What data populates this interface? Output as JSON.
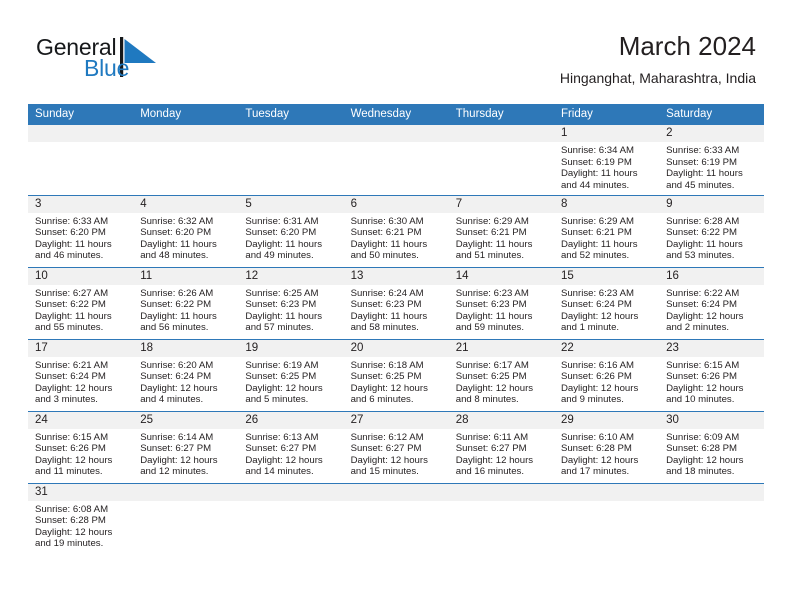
{
  "brand": {
    "name_part1": "General",
    "name_part2": "Blue",
    "mark": "triangle-flag",
    "colors": {
      "blue": "#1f79c0",
      "header_blue": "#2e78b8",
      "band_gray": "#f1f1f1"
    }
  },
  "header": {
    "title": "March 2024",
    "subtitle": "Hinganghat, Maharashtra, India"
  },
  "calendar": {
    "weekday_headers": [
      "Sunday",
      "Monday",
      "Tuesday",
      "Wednesday",
      "Thursday",
      "Friday",
      "Saturday"
    ],
    "weeks": [
      [
        {
          "day": "",
          "sunrise": "",
          "sunset": "",
          "daylight_line1": "",
          "daylight_line2": ""
        },
        {
          "day": "",
          "sunrise": "",
          "sunset": "",
          "daylight_line1": "",
          "daylight_line2": ""
        },
        {
          "day": "",
          "sunrise": "",
          "sunset": "",
          "daylight_line1": "",
          "daylight_line2": ""
        },
        {
          "day": "",
          "sunrise": "",
          "sunset": "",
          "daylight_line1": "",
          "daylight_line2": ""
        },
        {
          "day": "",
          "sunrise": "",
          "sunset": "",
          "daylight_line1": "",
          "daylight_line2": ""
        },
        {
          "day": "1",
          "sunrise": "Sunrise: 6:34 AM",
          "sunset": "Sunset: 6:19 PM",
          "daylight_line1": "Daylight: 11 hours",
          "daylight_line2": "and 44 minutes."
        },
        {
          "day": "2",
          "sunrise": "Sunrise: 6:33 AM",
          "sunset": "Sunset: 6:19 PM",
          "daylight_line1": "Daylight: 11 hours",
          "daylight_line2": "and 45 minutes."
        }
      ],
      [
        {
          "day": "3",
          "sunrise": "Sunrise: 6:33 AM",
          "sunset": "Sunset: 6:20 PM",
          "daylight_line1": "Daylight: 11 hours",
          "daylight_line2": "and 46 minutes."
        },
        {
          "day": "4",
          "sunrise": "Sunrise: 6:32 AM",
          "sunset": "Sunset: 6:20 PM",
          "daylight_line1": "Daylight: 11 hours",
          "daylight_line2": "and 48 minutes."
        },
        {
          "day": "5",
          "sunrise": "Sunrise: 6:31 AM",
          "sunset": "Sunset: 6:20 PM",
          "daylight_line1": "Daylight: 11 hours",
          "daylight_line2": "and 49 minutes."
        },
        {
          "day": "6",
          "sunrise": "Sunrise: 6:30 AM",
          "sunset": "Sunset: 6:21 PM",
          "daylight_line1": "Daylight: 11 hours",
          "daylight_line2": "and 50 minutes."
        },
        {
          "day": "7",
          "sunrise": "Sunrise: 6:29 AM",
          "sunset": "Sunset: 6:21 PM",
          "daylight_line1": "Daylight: 11 hours",
          "daylight_line2": "and 51 minutes."
        },
        {
          "day": "8",
          "sunrise": "Sunrise: 6:29 AM",
          "sunset": "Sunset: 6:21 PM",
          "daylight_line1": "Daylight: 11 hours",
          "daylight_line2": "and 52 minutes."
        },
        {
          "day": "9",
          "sunrise": "Sunrise: 6:28 AM",
          "sunset": "Sunset: 6:22 PM",
          "daylight_line1": "Daylight: 11 hours",
          "daylight_line2": "and 53 minutes."
        }
      ],
      [
        {
          "day": "10",
          "sunrise": "Sunrise: 6:27 AM",
          "sunset": "Sunset: 6:22 PM",
          "daylight_line1": "Daylight: 11 hours",
          "daylight_line2": "and 55 minutes."
        },
        {
          "day": "11",
          "sunrise": "Sunrise: 6:26 AM",
          "sunset": "Sunset: 6:22 PM",
          "daylight_line1": "Daylight: 11 hours",
          "daylight_line2": "and 56 minutes."
        },
        {
          "day": "12",
          "sunrise": "Sunrise: 6:25 AM",
          "sunset": "Sunset: 6:23 PM",
          "daylight_line1": "Daylight: 11 hours",
          "daylight_line2": "and 57 minutes."
        },
        {
          "day": "13",
          "sunrise": "Sunrise: 6:24 AM",
          "sunset": "Sunset: 6:23 PM",
          "daylight_line1": "Daylight: 11 hours",
          "daylight_line2": "and 58 minutes."
        },
        {
          "day": "14",
          "sunrise": "Sunrise: 6:23 AM",
          "sunset": "Sunset: 6:23 PM",
          "daylight_line1": "Daylight: 11 hours",
          "daylight_line2": "and 59 minutes."
        },
        {
          "day": "15",
          "sunrise": "Sunrise: 6:23 AM",
          "sunset": "Sunset: 6:24 PM",
          "daylight_line1": "Daylight: 12 hours",
          "daylight_line2": "and 1 minute."
        },
        {
          "day": "16",
          "sunrise": "Sunrise: 6:22 AM",
          "sunset": "Sunset: 6:24 PM",
          "daylight_line1": "Daylight: 12 hours",
          "daylight_line2": "and 2 minutes."
        }
      ],
      [
        {
          "day": "17",
          "sunrise": "Sunrise: 6:21 AM",
          "sunset": "Sunset: 6:24 PM",
          "daylight_line1": "Daylight: 12 hours",
          "daylight_line2": "and 3 minutes."
        },
        {
          "day": "18",
          "sunrise": "Sunrise: 6:20 AM",
          "sunset": "Sunset: 6:24 PM",
          "daylight_line1": "Daylight: 12 hours",
          "daylight_line2": "and 4 minutes."
        },
        {
          "day": "19",
          "sunrise": "Sunrise: 6:19 AM",
          "sunset": "Sunset: 6:25 PM",
          "daylight_line1": "Daylight: 12 hours",
          "daylight_line2": "and 5 minutes."
        },
        {
          "day": "20",
          "sunrise": "Sunrise: 6:18 AM",
          "sunset": "Sunset: 6:25 PM",
          "daylight_line1": "Daylight: 12 hours",
          "daylight_line2": "and 6 minutes."
        },
        {
          "day": "21",
          "sunrise": "Sunrise: 6:17 AM",
          "sunset": "Sunset: 6:25 PM",
          "daylight_line1": "Daylight: 12 hours",
          "daylight_line2": "and 8 minutes."
        },
        {
          "day": "22",
          "sunrise": "Sunrise: 6:16 AM",
          "sunset": "Sunset: 6:26 PM",
          "daylight_line1": "Daylight: 12 hours",
          "daylight_line2": "and 9 minutes."
        },
        {
          "day": "23",
          "sunrise": "Sunrise: 6:15 AM",
          "sunset": "Sunset: 6:26 PM",
          "daylight_line1": "Daylight: 12 hours",
          "daylight_line2": "and 10 minutes."
        }
      ],
      [
        {
          "day": "24",
          "sunrise": "Sunrise: 6:15 AM",
          "sunset": "Sunset: 6:26 PM",
          "daylight_line1": "Daylight: 12 hours",
          "daylight_line2": "and 11 minutes."
        },
        {
          "day": "25",
          "sunrise": "Sunrise: 6:14 AM",
          "sunset": "Sunset: 6:27 PM",
          "daylight_line1": "Daylight: 12 hours",
          "daylight_line2": "and 12 minutes."
        },
        {
          "day": "26",
          "sunrise": "Sunrise: 6:13 AM",
          "sunset": "Sunset: 6:27 PM",
          "daylight_line1": "Daylight: 12 hours",
          "daylight_line2": "and 14 minutes."
        },
        {
          "day": "27",
          "sunrise": "Sunrise: 6:12 AM",
          "sunset": "Sunset: 6:27 PM",
          "daylight_line1": "Daylight: 12 hours",
          "daylight_line2": "and 15 minutes."
        },
        {
          "day": "28",
          "sunrise": "Sunrise: 6:11 AM",
          "sunset": "Sunset: 6:27 PM",
          "daylight_line1": "Daylight: 12 hours",
          "daylight_line2": "and 16 minutes."
        },
        {
          "day": "29",
          "sunrise": "Sunrise: 6:10 AM",
          "sunset": "Sunset: 6:28 PM",
          "daylight_line1": "Daylight: 12 hours",
          "daylight_line2": "and 17 minutes."
        },
        {
          "day": "30",
          "sunrise": "Sunrise: 6:09 AM",
          "sunset": "Sunset: 6:28 PM",
          "daylight_line1": "Daylight: 12 hours",
          "daylight_line2": "and 18 minutes."
        }
      ],
      [
        {
          "day": "31",
          "sunrise": "Sunrise: 6:08 AM",
          "sunset": "Sunset: 6:28 PM",
          "daylight_line1": "Daylight: 12 hours",
          "daylight_line2": "and 19 minutes."
        },
        {
          "day": "",
          "sunrise": "",
          "sunset": "",
          "daylight_line1": "",
          "daylight_line2": ""
        },
        {
          "day": "",
          "sunrise": "",
          "sunset": "",
          "daylight_line1": "",
          "daylight_line2": ""
        },
        {
          "day": "",
          "sunrise": "",
          "sunset": "",
          "daylight_line1": "",
          "daylight_line2": ""
        },
        {
          "day": "",
          "sunrise": "",
          "sunset": "",
          "daylight_line1": "",
          "daylight_line2": ""
        },
        {
          "day": "",
          "sunrise": "",
          "sunset": "",
          "daylight_line1": "",
          "daylight_line2": ""
        },
        {
          "day": "",
          "sunrise": "",
          "sunset": "",
          "daylight_line1": "",
          "daylight_line2": ""
        }
      ]
    ]
  }
}
